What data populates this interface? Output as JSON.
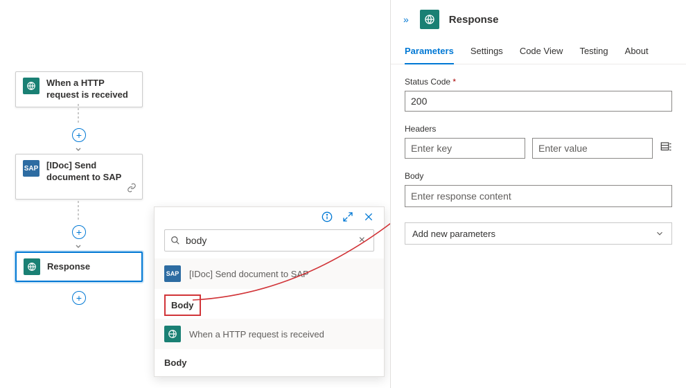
{
  "workflow": {
    "nodes": [
      {
        "label": "When a HTTP request is received",
        "icon": "teal"
      },
      {
        "label": "[IDoc] Send document to SAP",
        "icon": "sap",
        "sapText": "SAP"
      },
      {
        "label": "Response",
        "icon": "teal",
        "selected": true
      }
    ]
  },
  "picker": {
    "searchValue": "body",
    "group1": {
      "label": "[IDoc] Send document to SAP",
      "sapText": "SAP"
    },
    "token1": "Body",
    "group2": {
      "label": "When a HTTP request is received"
    },
    "token2": "Body"
  },
  "panel": {
    "title": "Response",
    "tabs": {
      "parameters": "Parameters",
      "settings": "Settings",
      "codeview": "Code View",
      "testing": "Testing",
      "about": "About"
    },
    "statusLabel": "Status Code",
    "statusRequired": "*",
    "statusValue": "200",
    "headersLabel": "Headers",
    "headerKeyPlaceholder": "Enter key",
    "headerValuePlaceholder": "Enter value",
    "bodyLabel": "Body",
    "bodyPlaceholder": "Enter response content",
    "addParam": "Add new parameters"
  }
}
